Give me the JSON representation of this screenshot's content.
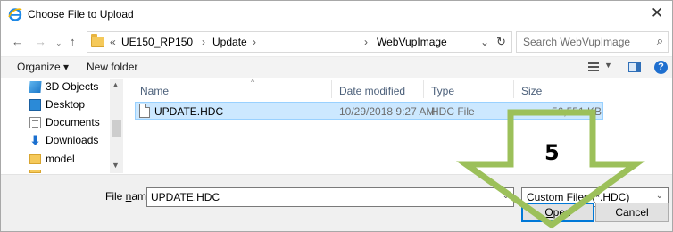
{
  "window": {
    "title": "Choose File to Upload",
    "close_glyph": "✕"
  },
  "nav": {
    "back_glyph": "←",
    "forward_glyph": "→",
    "recent_glyph": "⌄",
    "up_glyph": "↑"
  },
  "address": {
    "overflow": "«",
    "segments": [
      "UE150_RP150",
      "Update",
      "WebVupImage"
    ],
    "separator": "›",
    "dropdown_glyph": "⌄",
    "refresh_glyph": "↻"
  },
  "search": {
    "placeholder": "Search WebVupImage",
    "icon_glyph": "⌕"
  },
  "toolbar": {
    "organize_label": "Organize ▾",
    "new_folder_label": "New folder",
    "view_dropdown_glyph": "▼",
    "help_glyph": "?"
  },
  "sidebar": {
    "items": [
      {
        "label": "3D Objects",
        "icon": "3d-objects-icon"
      },
      {
        "label": "Desktop",
        "icon": "desktop-icon"
      },
      {
        "label": "Documents",
        "icon": "documents-icon"
      },
      {
        "label": "Downloads",
        "icon": "downloads-icon"
      },
      {
        "label": "model",
        "icon": "folder-icon"
      }
    ],
    "scroll_up_glyph": "▲",
    "scroll_down_glyph": "▼"
  },
  "file_list": {
    "columns": [
      "Name",
      "Date modified",
      "Type",
      "Size"
    ],
    "sort_glyph": "^",
    "rows": [
      {
        "name": "UPDATE.HDC",
        "date": "10/29/2018 9:27 AM",
        "type": "HDC File",
        "size": "56,551 KB"
      }
    ]
  },
  "footer": {
    "file_name_label_prefix": "File ",
    "file_name_label_ul": "n",
    "file_name_label_suffix": "ame:",
    "file_name_value": "UPDATE.HDC",
    "dropdown_glyph": "⌄",
    "filter_value": "Custom Files (*.HDC)",
    "open_ul": "O",
    "open_rest": "pen",
    "cancel_label": "Cancel"
  },
  "annotation": {
    "step_number": "5",
    "arrow_color": "#9cc05a",
    "arrow_stroke": "#7aa03a"
  },
  "colors": {
    "selection_bg": "#cce8ff",
    "selection_border": "#99d1ff",
    "primary_button_border": "#0078d7",
    "header_text": "#4c607a"
  }
}
